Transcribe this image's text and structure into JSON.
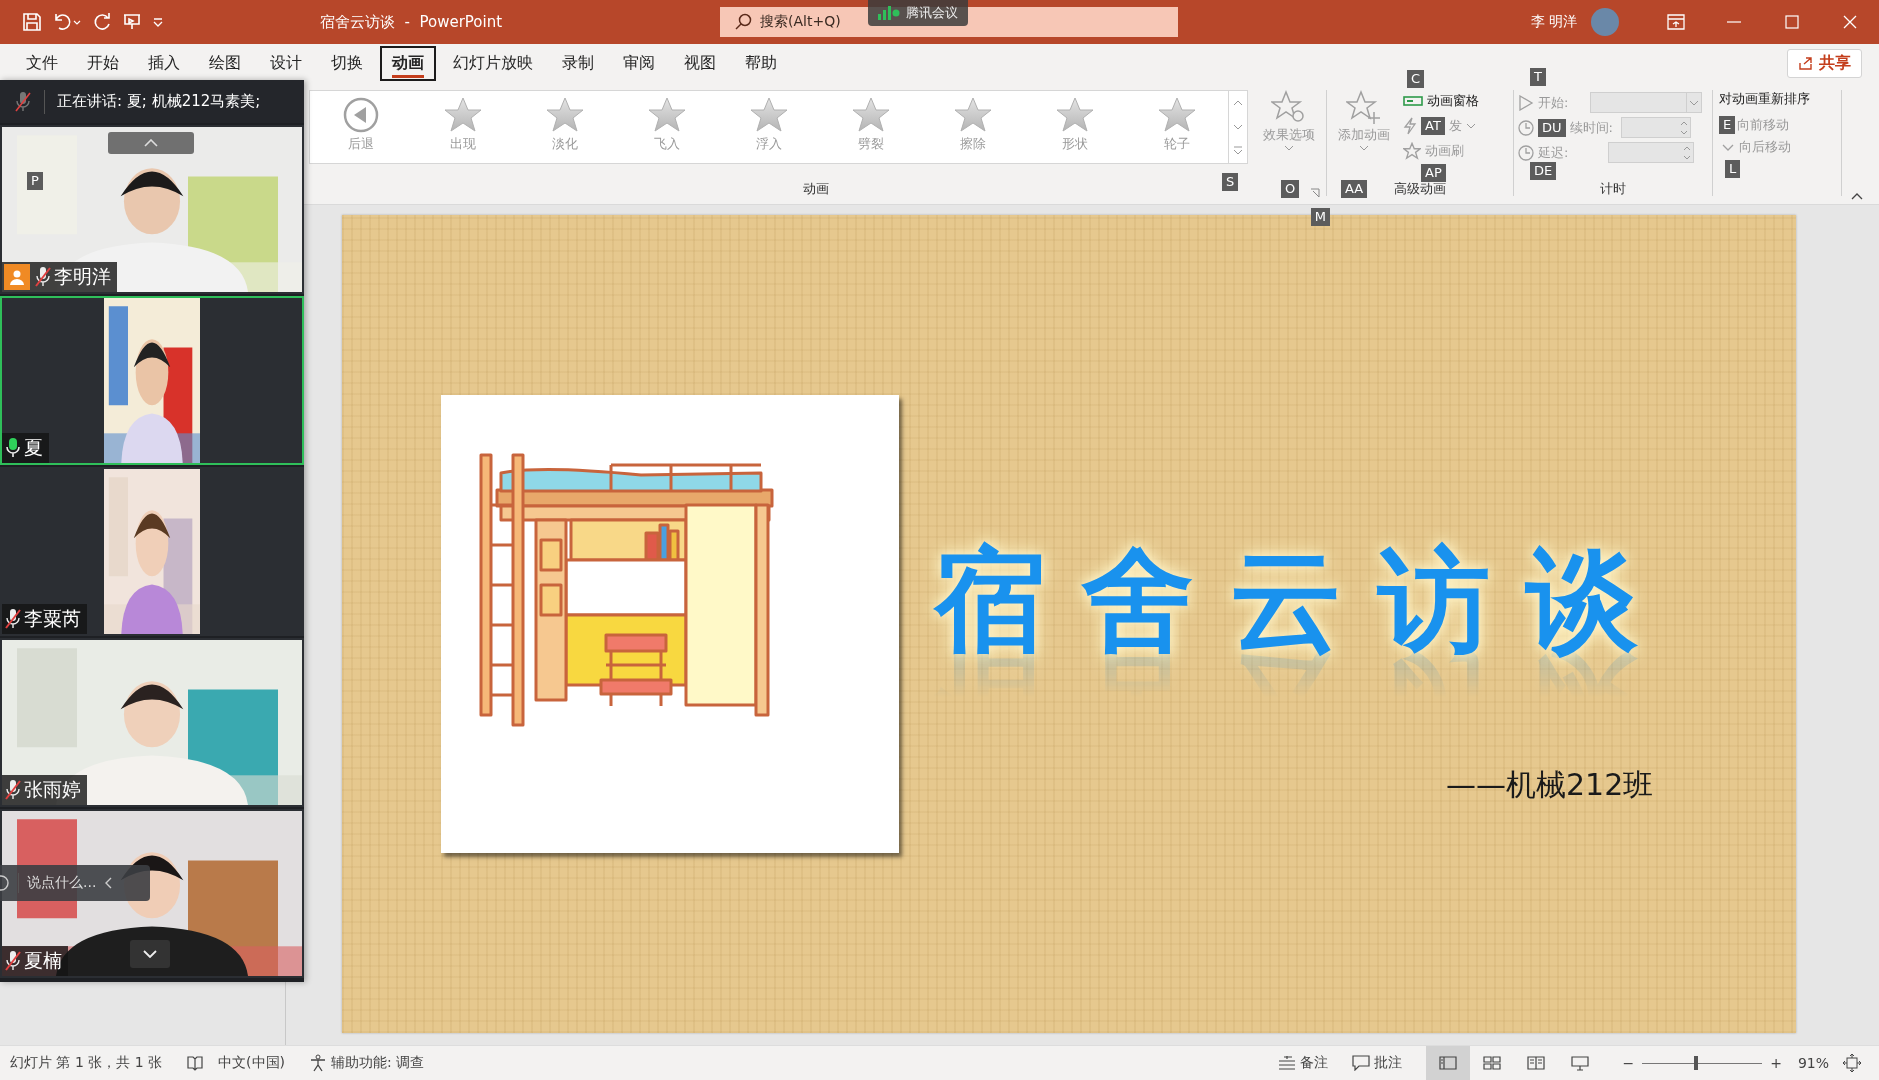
{
  "title_bar": {
    "title": "宿舍云访谈  -  PowerPoint",
    "search_placeholder": "搜索(Alt+Q)",
    "user": "李 明洋"
  },
  "meeting_badge": {
    "label": "腾讯会议"
  },
  "menu_tabs": [
    {
      "label": "文件",
      "selected": false
    },
    {
      "label": "开始",
      "selected": false
    },
    {
      "label": "插入",
      "selected": false
    },
    {
      "label": "绘图",
      "selected": false
    },
    {
      "label": "设计",
      "selected": false
    },
    {
      "label": "切换",
      "selected": false
    },
    {
      "label": "动画",
      "selected": true
    },
    {
      "label": "幻灯片放映",
      "selected": false
    },
    {
      "label": "录制",
      "selected": false
    },
    {
      "label": "审阅",
      "selected": false
    },
    {
      "label": "视图",
      "selected": false
    },
    {
      "label": "帮助",
      "selected": false
    }
  ],
  "share_button": "共享",
  "ribbon": {
    "gallery": [
      {
        "label": "后退",
        "kind": "back",
        "disabled": true
      },
      {
        "label": "出现",
        "kind": "star",
        "disabled": true
      },
      {
        "label": "淡化",
        "kind": "star",
        "disabled": true
      },
      {
        "label": "飞入",
        "kind": "star",
        "disabled": true
      },
      {
        "label": "浮入",
        "kind": "star",
        "disabled": true
      },
      {
        "label": "劈裂",
        "kind": "star",
        "disabled": true
      },
      {
        "label": "擦除",
        "kind": "star",
        "disabled": true
      },
      {
        "label": "形状",
        "kind": "star",
        "disabled": true
      },
      {
        "label": "轮子",
        "kind": "star",
        "disabled": true
      }
    ],
    "gallery_keytip": "S",
    "effect_options": {
      "label": "效果选项",
      "disabled": true,
      "keytip": "O"
    },
    "animation_group": {
      "label": "动画",
      "keytip": "M"
    },
    "add_animation": {
      "label": "添加动画",
      "disabled": true,
      "keytip": "AA"
    },
    "animation_pane": {
      "label": "动画窗格",
      "disabled": false,
      "keytip": "C"
    },
    "trigger": {
      "label": "发",
      "disabled": true,
      "keytip": "AT"
    },
    "animation_painter": {
      "label": "动画刷",
      "disabled": true,
      "keytip": "AP"
    },
    "advanced_group": {
      "label": "高级动画"
    },
    "timing_fields": [
      {
        "label": "开始:",
        "kind": "dropdown",
        "keytip": "T"
      },
      {
        "label": "续时间:",
        "kind": "spinner",
        "keytip": "DU"
      },
      {
        "label": "延迟:",
        "kind": "spinner",
        "keytip": "DE"
      }
    ],
    "timing_group": {
      "label": "计时"
    },
    "reorder_title": "对动画重新排序",
    "move_earlier": {
      "label": "向前移动",
      "disabled": true,
      "keytip": "E"
    },
    "move_later": {
      "label": "向后移动",
      "disabled": true,
      "keytip": "L"
    }
  },
  "meeting": {
    "speaking_now": "正在讲话: 夏; 机械212马素美;",
    "keytip": "P",
    "chat_placeholder": "说点什么...",
    "participants": [
      {
        "name": "李明洋",
        "host": true,
        "muted": true,
        "speaking": false,
        "kind": "full"
      },
      {
        "name": "夏",
        "host": false,
        "muted": false,
        "speaking": true,
        "kind": "portrait"
      },
      {
        "name": "李粟芮",
        "host": false,
        "muted": true,
        "speaking": false,
        "kind": "portrait"
      },
      {
        "name": "张雨婷",
        "host": false,
        "muted": true,
        "speaking": false,
        "kind": "full"
      },
      {
        "name": "夏楠",
        "host": false,
        "muted": true,
        "speaking": false,
        "kind": "full"
      }
    ]
  },
  "slide": {
    "title": "宿舍云访谈",
    "subtitle": "——机械212班"
  },
  "status_bar": {
    "slide_info": "幻灯片 第 1 张，共 1 张",
    "language": "中文(中国)",
    "accessibility": "辅助功能: 调查",
    "notes": "备注",
    "comments": "批注",
    "views": [
      {
        "selected": true
      },
      {
        "selected": false
      },
      {
        "selected": false
      },
      {
        "selected": false
      }
    ],
    "zoom_minus": "−",
    "zoom_plus": "+",
    "zoom": {
      "level": 0.45
    },
    "zoom_value": "91%"
  }
}
